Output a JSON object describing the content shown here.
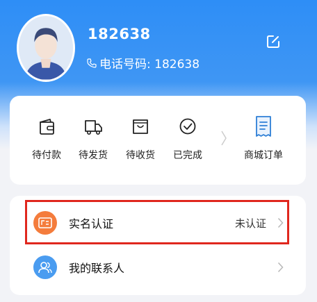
{
  "profile": {
    "username": "182638",
    "phone_label": "电话号码: 182638"
  },
  "orders": {
    "items": [
      {
        "label": "待付款",
        "icon": "wallet-icon"
      },
      {
        "label": "待发货",
        "icon": "truck-icon"
      },
      {
        "label": "待收货",
        "icon": "box-icon"
      },
      {
        "label": "已完成",
        "icon": "check-circle-icon"
      }
    ],
    "mall_orders_label": "商城订单"
  },
  "menu": {
    "items": [
      {
        "label": "实名认证",
        "status": "未认证",
        "icon": "id-card-icon"
      },
      {
        "label": "我的联系人",
        "status": "",
        "icon": "contacts-icon"
      }
    ]
  },
  "colors": {
    "primary_blue": "#2e8ef6",
    "highlight_red": "#e0271e",
    "id_card_orange": "#f47c3c",
    "contacts_blue": "#4a9cf0"
  }
}
